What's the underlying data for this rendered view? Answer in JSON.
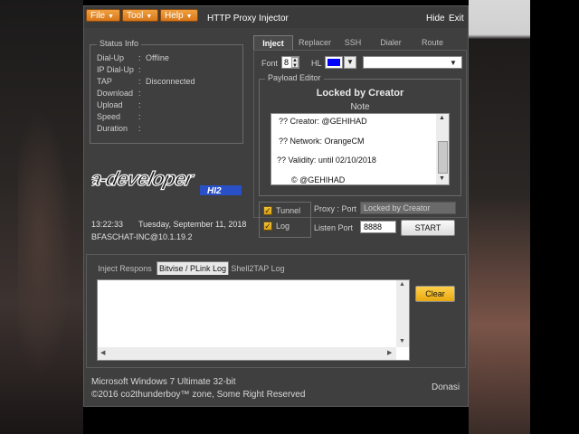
{
  "window": {
    "title": "HTTP Proxy Injector",
    "menu": [
      {
        "label": "File"
      },
      {
        "label": "Tool"
      },
      {
        "label": "Help"
      }
    ],
    "hide_label": "Hide",
    "exit_label": "Exit"
  },
  "status_info": {
    "title": "Status Info",
    "rows": [
      {
        "label": "Dial-Up",
        "value": "Offline"
      },
      {
        "label": "IP Dial-Up",
        "value": ""
      },
      {
        "label": "TAP",
        "value": "Disconnected"
      },
      {
        "label": "Download",
        "value": ""
      },
      {
        "label": "Upload",
        "value": ""
      },
      {
        "label": "Speed",
        "value": ""
      },
      {
        "label": "Duration",
        "value": ""
      }
    ],
    "separator": ":"
  },
  "logo_text": "a-developer HI2",
  "clock": {
    "time": "13:22:33",
    "date": "Tuesday, September 11, 2018",
    "host": "BFASCHAT-INC@10.1.19.2"
  },
  "tabs": [
    "Inject",
    "Replacer",
    "SSH",
    "Dialer",
    "Route"
  ],
  "font_row": {
    "font_label": "Font",
    "font_value": "8",
    "hl_label": "HL",
    "hl_color": "#0000ff",
    "combo_value": ""
  },
  "payload_editor": {
    "title": "Payload Editor",
    "locked_title": "Locked by Creator",
    "note_label": "Note",
    "lines": [
      "?? Creator: @GEHIHAD",
      "?? Network: OrangeCM",
      "?? Validity: until 02/10/2018",
      "© @GEHIHAD"
    ]
  },
  "options": {
    "tunnel_label": "Tunnel",
    "log_label": "Log",
    "proxy_label": "Proxy : Port",
    "proxy_value": "Locked by Creator",
    "listen_label": "Listen Port",
    "listen_value": "8888",
    "start_label": "START"
  },
  "log_tabs": [
    "Inject Respons",
    "Bitvise / PLink Log",
    "Shell2TAP Log"
  ],
  "clear_label": "Clear",
  "footer": {
    "os": "Microsoft Windows 7 Ultimate  32-bit",
    "copyright": "©2016 co2thunderboy™ zone, Some Right Reserved",
    "donate": "Donasi"
  },
  "colors": {
    "accent_orange": "#e8892a",
    "window_bg": "#3f3f3f",
    "logo_blue": "#2a50c8"
  }
}
